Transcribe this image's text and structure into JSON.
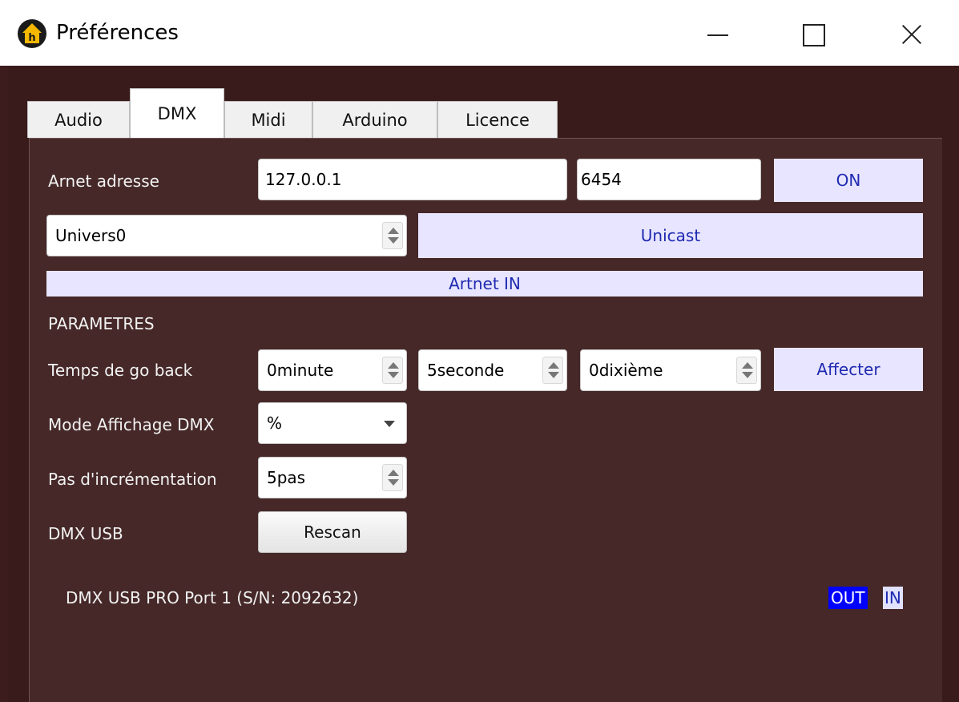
{
  "window": {
    "title": "Préférences"
  },
  "tabs": [
    {
      "label": "Audio"
    },
    {
      "label": "DMX"
    },
    {
      "label": "Midi"
    },
    {
      "label": "Arduino"
    },
    {
      "label": "Licence"
    }
  ],
  "active_tab": "DMX",
  "artnet": {
    "label": "Arnet adresse",
    "address": "127.0.0.1",
    "port": "6454",
    "on_button": "ON",
    "universe": "Univers0",
    "mode_button": "Unicast",
    "in_button": "Artnet IN"
  },
  "parametres": {
    "section_label": "PARAMETRES",
    "go_back": {
      "label": "Temps de go back",
      "minutes": "0minute",
      "seconds": "5seconde",
      "tenths": "0dixième",
      "apply_button": "Affecter"
    },
    "display_mode": {
      "label": "Mode Affichage DMX",
      "value": "%"
    },
    "increment": {
      "label": "Pas d'incrémentation",
      "value": "5pas"
    }
  },
  "dmx_usb": {
    "label": "DMX USB",
    "rescan_button": "Rescan",
    "device": "DMX USB PRO Port 1 (S/N: 2092632)",
    "out_label": "OUT",
    "in_label": "IN"
  },
  "colors": {
    "panel_bg": "#462828",
    "accent_button": "#e7e5ff",
    "accent_text": "#1f2ab0",
    "out_active": "#0000ff"
  }
}
